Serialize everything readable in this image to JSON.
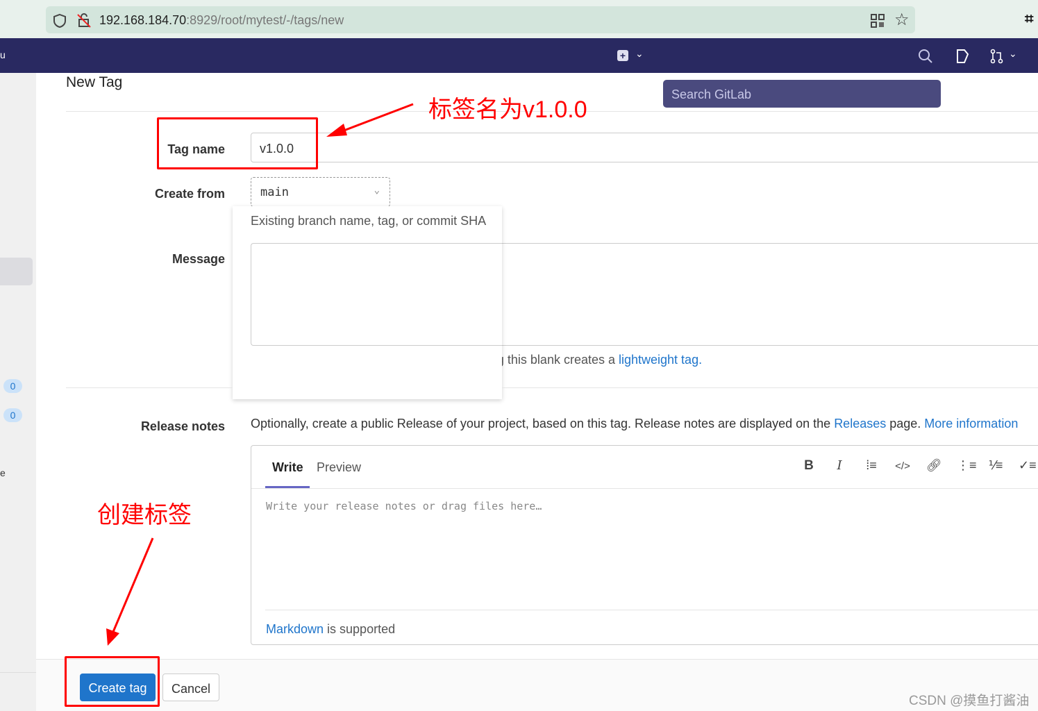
{
  "browser": {
    "url_host": "192.168.184.70",
    "url_path": ":8929/root/mytest/-/tags/new"
  },
  "header": {
    "search_placeholder": "Search GitLab"
  },
  "sidebar": {
    "badges": [
      "0",
      "0"
    ],
    "partial_left_text": "u",
    "partial_bottom_text": "e"
  },
  "page": {
    "title": "New Tag"
  },
  "form": {
    "tag_name_label": "Tag name",
    "tag_name_value": "v1.0.0",
    "create_from_label": "Create from",
    "create_from_value": "main",
    "create_from_help": "Existing branch name, tag, or commit SHA",
    "message_label": "Message",
    "message_value": "",
    "message_help": "Optionally, add a message to the tag. Leaving this blank creates a ",
    "message_help_link": "lightweight tag",
    "message_help_end": ".",
    "release_notes_label": "Release notes",
    "release_help": "Optionally, create a public Release of your project, based on this tag. Release notes are displayed on the ",
    "release_help_link": "Releases",
    "release_help_mid": " page. ",
    "release_help_link2": "More information",
    "editor_tabs": [
      "Write",
      "Preview"
    ],
    "editor_placeholder": "Write your release notes or drag files here…",
    "markdown_link": "Markdown",
    "markdown_suffix": " is supported"
  },
  "actions": {
    "create": "Create tag",
    "cancel": "Cancel"
  },
  "annotations": {
    "tag_note": "标签名为v1.0.0",
    "create_note": "创建标签"
  },
  "watermark": "CSDN @摸鱼打酱油",
  "colors": {
    "header": "#292961",
    "primary": "#1f75cb",
    "annotation": "#ff0000"
  }
}
